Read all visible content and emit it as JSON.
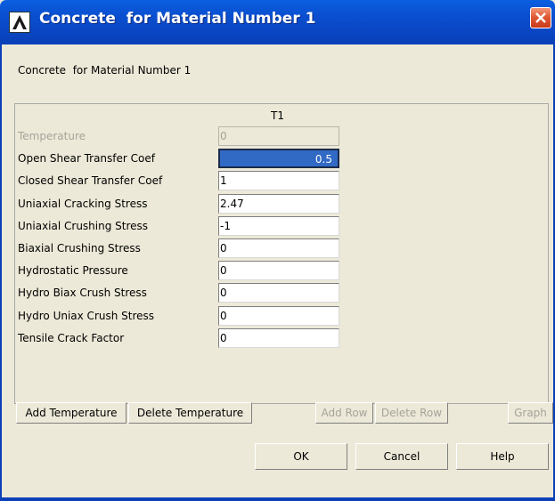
{
  "window": {
    "title": "Concrete  for Material Number 1",
    "app_icon": "ansys-logo-icon",
    "close_icon": "close-icon"
  },
  "dialog": {
    "heading": "Concrete  for Material Number 1",
    "column_header": "T1",
    "rows": [
      {
        "label": "Temperature",
        "value": "0",
        "disabled": true
      },
      {
        "label": "Open Shear Transfer Coef",
        "value": "0.5",
        "selected": true
      },
      {
        "label": "Closed Shear Transfer Coef",
        "value": "1"
      },
      {
        "label": "Uniaxial Cracking Stress",
        "value": "2.47"
      },
      {
        "label": "Uniaxial Crushing Stress",
        "value": "-1"
      },
      {
        "label": "Biaxial Crushing Stress",
        "value": "0"
      },
      {
        "label": "Hydrostatic Pressure",
        "value": "0"
      },
      {
        "label": "Hydro Biax Crush Stress",
        "value": "0"
      },
      {
        "label": "Hydro Uniax Crush Stress",
        "value": "0"
      },
      {
        "label": "Tensile Crack Factor",
        "value": "0"
      }
    ]
  },
  "buttons": {
    "add_temperature": "Add Temperature",
    "delete_temperature": "Delete Temperature",
    "add_row": "Add Row",
    "delete_row": "Delete Row",
    "graph": "Graph",
    "ok": "OK",
    "cancel": "Cancel",
    "help": "Help"
  },
  "colors": {
    "titlebar": "#0a4fd0",
    "selection": "#316ac5",
    "dialog_bg": "#ece9d8",
    "close_button": "#e05a35"
  }
}
